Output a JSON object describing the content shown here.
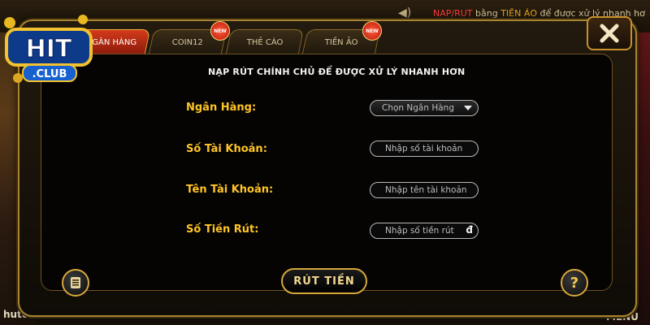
{
  "background": {
    "top_text_red": "NAP/RUT",
    "top_text_mid": " bằng ",
    "top_text_gold": "TIỀN ẢO",
    "top_text_rest": " để được xử lý nhanh hơ",
    "bottom_left": "hutcubclb",
    "bottom_right": "MENU"
  },
  "logo": {
    "top": "HIT",
    "bottom": ".CLUB"
  },
  "tabs": [
    {
      "label": "NGÂN HÀNG",
      "active": true
    },
    {
      "label": "COIN12",
      "badge": "NEW"
    },
    {
      "label": "THẺ CÀO"
    },
    {
      "label": "TIỀN ẢO",
      "badge": "NEW"
    }
  ],
  "notice": "NẠP RÚT CHÍNH CHỦ ĐỂ ĐƯỢC XỬ LÝ NHANH HƠN",
  "form": {
    "bank_label": "Ngân Hàng:",
    "bank_select": "Chọn Ngân Hàng",
    "account_number_label": "Số Tài Khoản:",
    "account_number_placeholder": "Nhập số tài  khoản",
    "account_name_label": "Tên Tài Khoản:",
    "account_name_placeholder": "Nhập tên tài khoản",
    "amount_label": "Số Tiền Rút:",
    "amount_placeholder": "Nhập số tiền rút",
    "currency": "đ"
  },
  "withdraw_button": "RÚT TIỀN",
  "help_button": "?",
  "colors": {
    "label": "#ffc426",
    "gold_border": "#d8a83a",
    "active_tab": "#d33a1a"
  }
}
